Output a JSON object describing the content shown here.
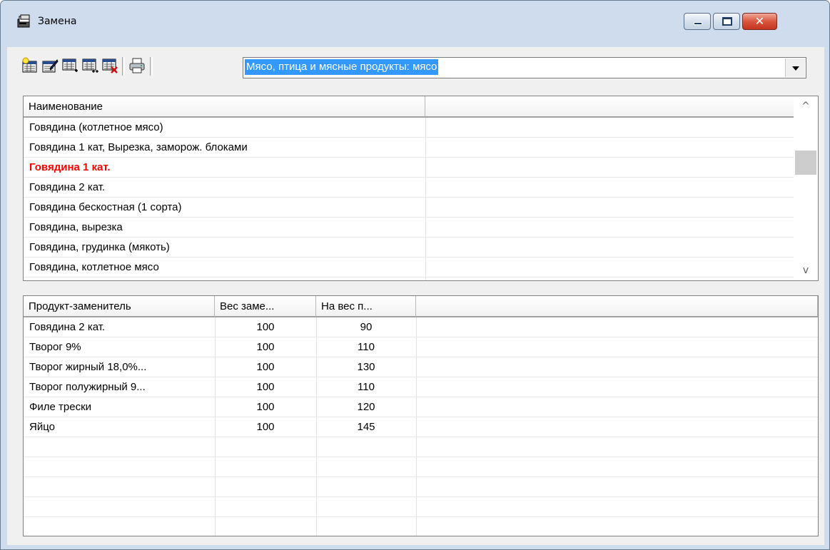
{
  "window": {
    "title": "Замена"
  },
  "toolbar": {
    "buttons": [
      {
        "icon": "new-record-icon"
      },
      {
        "icon": "edit-record-icon"
      },
      {
        "icon": "add-row-icon"
      },
      {
        "icon": "add-rows-icon"
      },
      {
        "icon": "delete-row-icon"
      },
      {
        "icon": "print-icon"
      }
    ],
    "category_value": "Мясо, птица и мясные продукты: мясо"
  },
  "products": {
    "columns": [
      "Наименование",
      ""
    ],
    "rows": [
      {
        "name": "Говядина (котлетное мясо)",
        "highlight": false
      },
      {
        "name": "Говядина 1 кат, Вырезка, заморож. блоками",
        "highlight": false
      },
      {
        "name": "Говядина 1 кат.",
        "highlight": true
      },
      {
        "name": "Говядина 2 кат.",
        "highlight": false
      },
      {
        "name": "Говядина бескостная (1 сорта)",
        "highlight": false
      },
      {
        "name": "Говядина, вырезка",
        "highlight": false
      },
      {
        "name": "Говядина, грудинка (мякоть)",
        "highlight": false
      },
      {
        "name": "Говядина, котлетное мясо",
        "highlight": false
      }
    ]
  },
  "substitutes": {
    "columns": [
      "Продукт-заменитель",
      "Вес заме...",
      "На вес п...",
      ""
    ],
    "rows": [
      {
        "product": "Говядина 2 кат.",
        "weight": "100",
        "per_weight": "90"
      },
      {
        "product": "Творог 9%",
        "weight": "100",
        "per_weight": "110"
      },
      {
        "product": "Творог жирный 18,0%...",
        "weight": "100",
        "per_weight": "130"
      },
      {
        "product": "Творог полужирный 9...",
        "weight": "100",
        "per_weight": "110"
      },
      {
        "product": "Филе трески",
        "weight": "100",
        "per_weight": "120"
      },
      {
        "product": "Яйцо",
        "weight": "100",
        "per_weight": "145"
      }
    ]
  },
  "colors": {
    "highlight_text": "#ff0000",
    "selection": "#3399ff"
  }
}
